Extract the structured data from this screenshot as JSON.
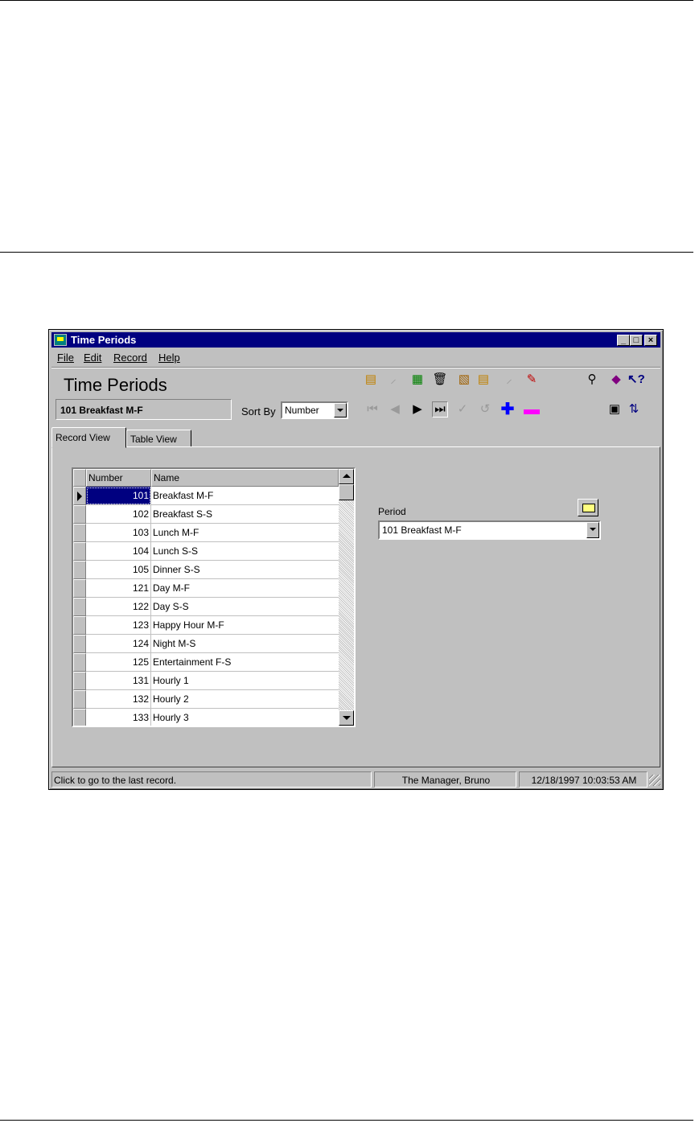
{
  "window": {
    "title": "Time Periods",
    "controls": {
      "minimize": "_",
      "maximize": "□",
      "close": "×"
    }
  },
  "menu": [
    "File",
    "Edit",
    "Record",
    "Help"
  ],
  "header": {
    "title": "Time Periods",
    "current_record": "101 Breakfast M-F",
    "sort_by_label": "Sort By",
    "sort_by_value": "Number"
  },
  "toolbar": {
    "top_icons": [
      "new-record-icon",
      "copy-icon",
      "paste-icon",
      "delete-icon",
      "clipboard-icon",
      "duplicate-icon",
      "undo-icon",
      "highlight-icon"
    ],
    "right_icons": [
      "find-icon",
      "book-icon",
      "help-pointer-icon"
    ],
    "nav_icons": [
      "first-record-icon",
      "previous-record-icon",
      "next-record-icon",
      "last-record-icon",
      "save-check-icon",
      "revert-icon",
      "add-record-icon",
      "remove-record-icon"
    ],
    "bottom_right_icons": [
      "window-icon",
      "transfer-icon"
    ]
  },
  "tabs": [
    "Record View",
    "Table View"
  ],
  "grid": {
    "columns": [
      "Number",
      "Name"
    ],
    "rows": [
      {
        "number": "101",
        "name": "Breakfast M-F"
      },
      {
        "number": "102",
        "name": "Breakfast S-S"
      },
      {
        "number": "103",
        "name": "Lunch M-F"
      },
      {
        "number": "104",
        "name": "Lunch S-S"
      },
      {
        "number": "105",
        "name": "Dinner S-S"
      },
      {
        "number": "121",
        "name": "Day M-F"
      },
      {
        "number": "122",
        "name": "Day S-S"
      },
      {
        "number": "123",
        "name": "Happy Hour M-F"
      },
      {
        "number": "124",
        "name": "Night M-S"
      },
      {
        "number": "125",
        "name": "Entertainment F-S"
      },
      {
        "number": "131",
        "name": "Hourly 1"
      },
      {
        "number": "132",
        "name": "Hourly 2"
      },
      {
        "number": "133",
        "name": "Hourly 3"
      }
    ]
  },
  "period": {
    "label": "Period",
    "value": "101  Breakfast M-F"
  },
  "status": {
    "message": "Click to go to the last record.",
    "user": "The Manager, Bruno",
    "datetime": "12/18/1997 10:03:53 AM"
  }
}
